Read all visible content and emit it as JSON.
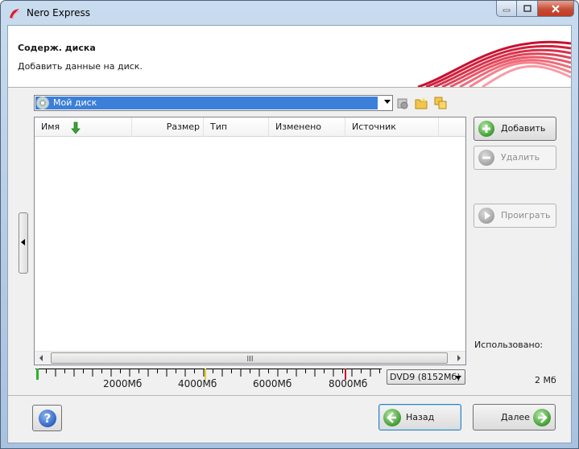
{
  "window": {
    "title": "Nero Express"
  },
  "header": {
    "title": "Содерж. диска",
    "subtitle": "Добавить данные на диск."
  },
  "disc_selector": {
    "value": "Мой диск"
  },
  "file_list": {
    "columns": [
      "Имя",
      "Размер",
      "Тип",
      "Изменено",
      "Источник"
    ],
    "rows": [],
    "scroll_grip": "III"
  },
  "side_buttons": {
    "add": "Добавить",
    "delete": "Удалить",
    "play": "Проиграть"
  },
  "capacity": {
    "ruler_labels": [
      "2000Мб",
      "4000Мб",
      "6000Мб",
      "8000Мб"
    ],
    "disc_type": "DVD9 (8152Мб)",
    "used_label": "Использовано:",
    "used_value": "2 Мб"
  },
  "footer": {
    "help": "?",
    "back": "Назад",
    "next": "Далее"
  }
}
